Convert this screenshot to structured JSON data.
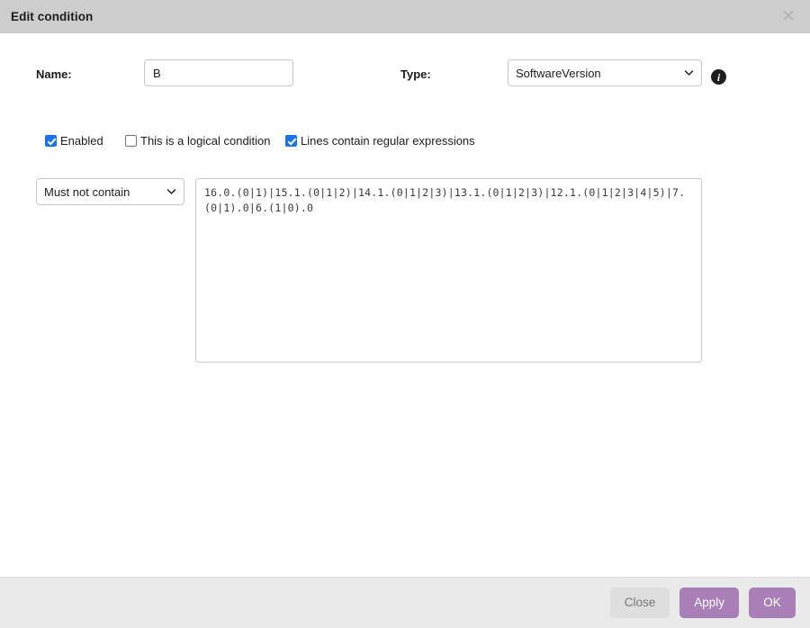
{
  "titlebar": {
    "title": "Edit condition",
    "close_icon": "close-icon",
    "close_glyph": "✕"
  },
  "form": {
    "name_label": "Name:",
    "name_value": "B",
    "name_placeholder": "",
    "type_label": "Type:",
    "type_value": "SoftwareVersion",
    "type_options": [
      "SoftwareVersion"
    ],
    "info_icon": "info-icon",
    "info_glyph": "i"
  },
  "checkboxes": [
    {
      "label": "Enabled",
      "checked": true
    },
    {
      "label": "This is a logical condition",
      "checked": false
    },
    {
      "label": "Lines contain regular expressions",
      "checked": true
    }
  ],
  "condition": {
    "operator_value": "Must not contain",
    "operator_options": [
      "Must not contain"
    ],
    "regex_value": "16.0.(0|1)|15.1.(0|1|2)|14.1.(0|1|2|3)|13.1.(0|1|2|3)|12.1.(0|1|2|3|4|5)|7.(0|1).0|6.(1|0).0",
    "regex_placeholder": ""
  },
  "footer": {
    "close_label": "Close",
    "apply_label": "Apply",
    "ok_label": "OK"
  },
  "colors": {
    "titlebar_bg": "#cdcdcd",
    "footer_bg": "#eaeaea",
    "accent_checkbox": "#1a73e8",
    "accent_button": "#a880b7",
    "neutral_button": "#dedede"
  }
}
